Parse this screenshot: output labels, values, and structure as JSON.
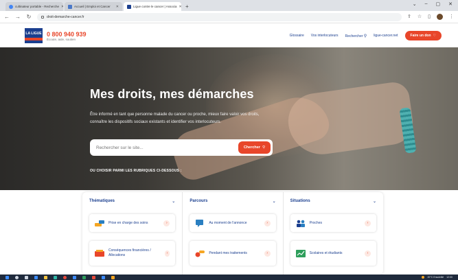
{
  "browser": {
    "tabs": [
      {
        "title": "cultinateur portable - Recherche",
        "active": false
      },
      {
        "title": "Accueil | Emploi et Cancer",
        "active": false
      },
      {
        "title": "Ligue contre le cancer | Associa",
        "active": true
      }
    ],
    "new_tab": "+",
    "url": "droit-demarche-cancer.fr"
  },
  "site": {
    "logo": "LA LIGUE",
    "phone": "0 800 940 939",
    "tagline": "Écoute, aide, soutien",
    "nav": [
      "Glossaire",
      "Vos interlocuteurs",
      "Rechercher",
      "ligue-cancer.net"
    ],
    "donate": "Faire un don"
  },
  "hero": {
    "title": "Mes droits, mes démarches",
    "lead": "Être informé en tant que personne malade du cancer ou proche, mieux faire valoir vos droits, connaître les dispositifs sociaux existants et identifier vos interlocuteurs.",
    "search_placeholder": "Rechercher sur le site...",
    "search_button": "Chercher",
    "pick_label": "OU CHOISIR PARMI LES RUBRIQUES CI-DESSOUS :"
  },
  "columns": [
    {
      "title": "Thématiques",
      "cards": [
        {
          "label": "Prise en charge des soins",
          "icon": "care-icon",
          "color": "#f5a623"
        },
        {
          "label": "Conséquences financières / Allocations",
          "icon": "money-icon",
          "color": "#e8462a"
        }
      ]
    },
    {
      "title": "Parcours",
      "cards": [
        {
          "label": "Au moment de l'annonce",
          "icon": "speech-icon",
          "color": "#2a7fc1"
        },
        {
          "label": "Pendant mes traitements",
          "icon": "pills-icon",
          "color": "#e8462a"
        }
      ]
    },
    {
      "title": "Situations",
      "cards": [
        {
          "label": "Proches",
          "icon": "people-icon",
          "color": "#1b3f8f"
        },
        {
          "label": "Scolaires et étudiants",
          "icon": "chart-icon",
          "color": "#2e9e5b"
        }
      ]
    }
  ],
  "taskbar": {
    "weather": "20°C Ensoleillé",
    "time": "12:00"
  },
  "colors": {
    "brand_blue": "#1b3f8f",
    "brand_orange": "#e8462a"
  }
}
